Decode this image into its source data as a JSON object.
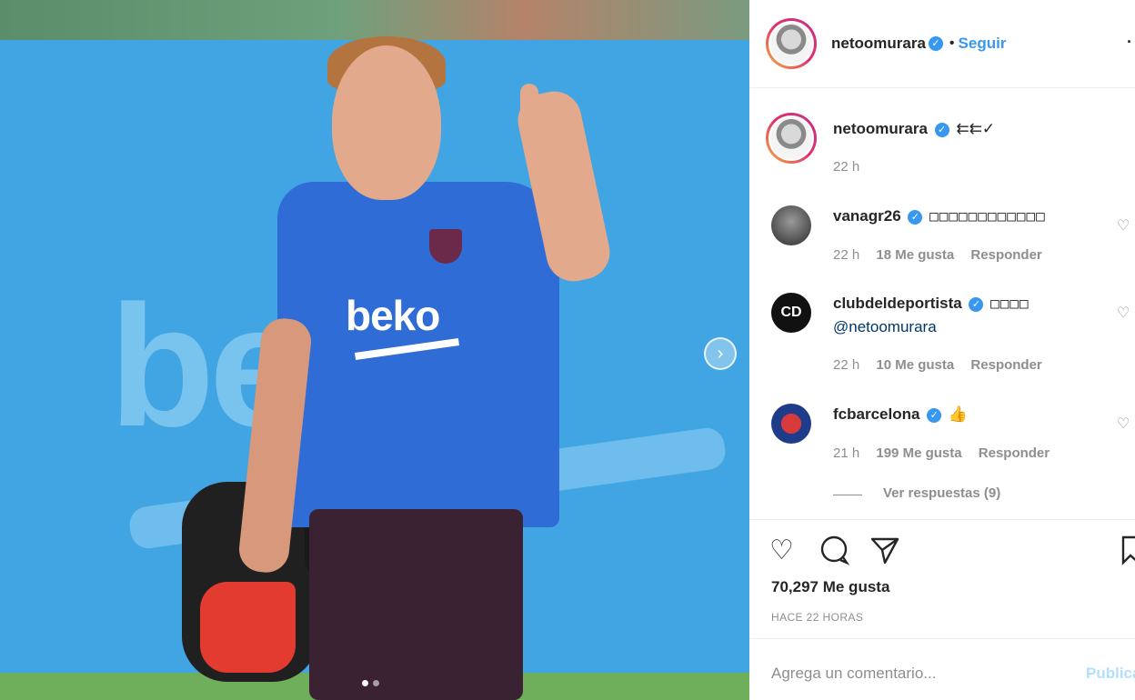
{
  "photo": {
    "shirt_sponsor": "beko",
    "background_sponsor": "beko",
    "carousel_next_icon": "chevron-right-icon",
    "carousel": {
      "slides": 2,
      "active": 1
    }
  },
  "header": {
    "username": "netoomurara",
    "verified_icon": "verified-badge-icon",
    "separator": "•",
    "follow_label": "Seguir",
    "more_icon": "more-options-icon"
  },
  "caption": {
    "username": "netoomurara",
    "text": "⇇⇇✓",
    "time": "22 h"
  },
  "comments": [
    {
      "username": "vanagr26",
      "text": "□□□□□□□□□□□□",
      "time": "22 h",
      "likes": "18 Me gusta",
      "reply": "Responder"
    },
    {
      "username": "clubdeldeportista",
      "text": "□□□□",
      "mention": "@netoomurara",
      "time": "22 h",
      "likes": "10 Me gusta",
      "reply": "Responder"
    },
    {
      "username": "fcbarcelona",
      "text": "👍",
      "time": "21 h",
      "likes": "199 Me gusta",
      "reply": "Responder"
    }
  ],
  "view_replies": "Ver respuestas (9)",
  "actions": {
    "like_icon": "heart-icon",
    "comment_icon": "comment-icon",
    "share_icon": "share-icon",
    "save_icon": "bookmark-icon"
  },
  "likes_count": "70,297 Me gusta",
  "posted_ago": "HACE 22 HORAS",
  "comment_box": {
    "placeholder": "Agrega un comentario...",
    "post_label": "Publicar"
  },
  "colors": {
    "link_blue": "#3897f0",
    "muted": "#8e8e8e",
    "post_disabled": "#b2dffc"
  }
}
